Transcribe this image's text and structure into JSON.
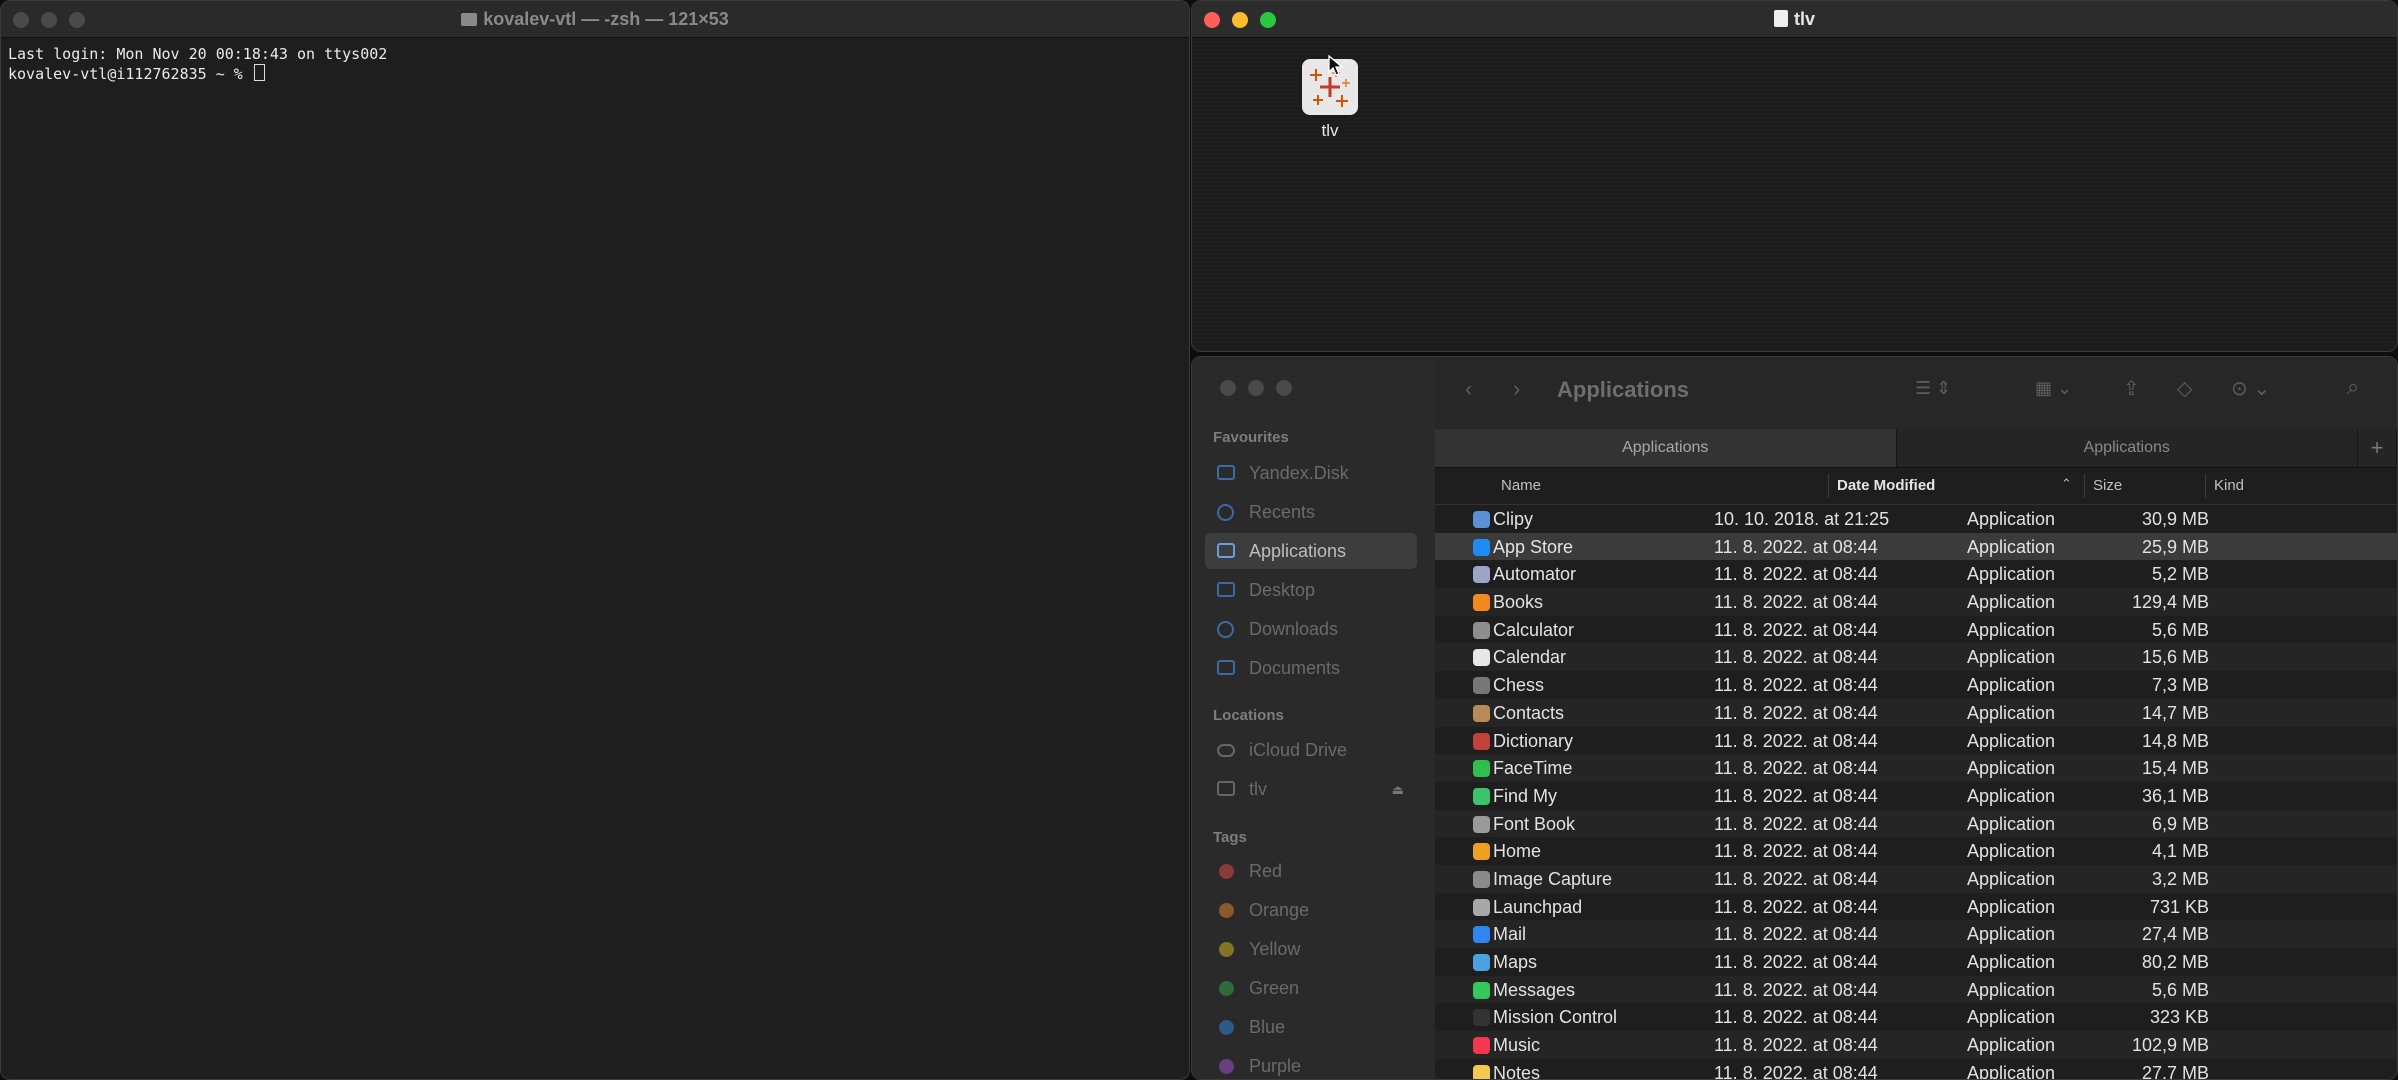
{
  "terminal": {
    "title": "kovalev-vtl — -zsh — 121×53",
    "lines": [
      "Last login: Mon Nov 20 00:18:43 on ttys002",
      "kovalev-vtl@i112762835 ~ % "
    ]
  },
  "volume_window": {
    "title": "tlv",
    "item_label": "tlv"
  },
  "finder": {
    "sidebar": {
      "favourites_label": "Favourites",
      "favourites": [
        "Yandex.Disk",
        "Recents",
        "Applications",
        "Desktop",
        "Downloads",
        "Documents"
      ],
      "locations_label": "Locations",
      "locations": [
        "iCloud Drive",
        "tlv"
      ],
      "tags_label": "Tags",
      "tags": [
        {
          "name": "Red",
          "color": "#8a3a38"
        },
        {
          "name": "Orange",
          "color": "#8a5a2a"
        },
        {
          "name": "Yellow",
          "color": "#857326"
        },
        {
          "name": "Green",
          "color": "#2f6b3a"
        },
        {
          "name": "Blue",
          "color": "#2e5a8a"
        },
        {
          "name": "Purple",
          "color": "#6a3f7e"
        }
      ]
    },
    "toolbar": {
      "title": "Applications"
    },
    "tabs": [
      "Applications",
      "Applications"
    ],
    "columns": {
      "name": "Name",
      "date": "Date Modified",
      "size": "Size",
      "kind": "Kind"
    },
    "rows": [
      {
        "name": "Clipy",
        "date": "10. 10. 2018. at 21:25",
        "size": "30,9 MB",
        "kind": "Application",
        "icon_color": "#5b8fd6"
      },
      {
        "name": "App Store",
        "date": "11. 8. 2022. at 08:44",
        "size": "25,9 MB",
        "kind": "Application",
        "icon_color": "#1b8cf3"
      },
      {
        "name": "Automator",
        "date": "11. 8. 2022. at 08:44",
        "size": "5,2 MB",
        "kind": "Application",
        "icon_color": "#9aa6c4"
      },
      {
        "name": "Books",
        "date": "11. 8. 2022. at 08:44",
        "size": "129,4 MB",
        "kind": "Application",
        "icon_color": "#f08a1c"
      },
      {
        "name": "Calculator",
        "date": "11. 8. 2022. at 08:44",
        "size": "5,6 MB",
        "kind": "Application",
        "icon_color": "#8e8e8e"
      },
      {
        "name": "Calendar",
        "date": "11. 8. 2022. at 08:44",
        "size": "15,6 MB",
        "kind": "Application",
        "icon_color": "#e8e8e8"
      },
      {
        "name": "Chess",
        "date": "11. 8. 2022. at 08:44",
        "size": "7,3 MB",
        "kind": "Application",
        "icon_color": "#777777"
      },
      {
        "name": "Contacts",
        "date": "11. 8. 2022. at 08:44",
        "size": "14,7 MB",
        "kind": "Application",
        "icon_color": "#b88a57"
      },
      {
        "name": "Dictionary",
        "date": "11. 8. 2022. at 08:44",
        "size": "14,8 MB",
        "kind": "Application",
        "icon_color": "#c2413b"
      },
      {
        "name": "FaceTime",
        "date": "11. 8. 2022. at 08:44",
        "size": "15,4 MB",
        "kind": "Application",
        "icon_color": "#2fbf4f"
      },
      {
        "name": "Find My",
        "date": "11. 8. 2022. at 08:44",
        "size": "36,1 MB",
        "kind": "Application",
        "icon_color": "#3ac36b"
      },
      {
        "name": "Font Book",
        "date": "11. 8. 2022. at 08:44",
        "size": "6,9 MB",
        "kind": "Application",
        "icon_color": "#9a9a9a"
      },
      {
        "name": "Home",
        "date": "11. 8. 2022. at 08:44",
        "size": "4,1 MB",
        "kind": "Application",
        "icon_color": "#f0a020"
      },
      {
        "name": "Image Capture",
        "date": "11. 8. 2022. at 08:44",
        "size": "3,2 MB",
        "kind": "Application",
        "icon_color": "#8a8a8a"
      },
      {
        "name": "Launchpad",
        "date": "11. 8. 2022. at 08:44",
        "size": "731 KB",
        "kind": "Application",
        "icon_color": "#a8a8a8"
      },
      {
        "name": "Mail",
        "date": "11. 8. 2022. at 08:44",
        "size": "27,4 MB",
        "kind": "Application",
        "icon_color": "#2f86f0"
      },
      {
        "name": "Maps",
        "date": "11. 8. 2022. at 08:44",
        "size": "80,2 MB",
        "kind": "Application",
        "icon_color": "#4aa3e0"
      },
      {
        "name": "Messages",
        "date": "11. 8. 2022. at 08:44",
        "size": "5,6 MB",
        "kind": "Application",
        "icon_color": "#34c759"
      },
      {
        "name": "Mission Control",
        "date": "11. 8. 2022. at 08:44",
        "size": "323 KB",
        "kind": "Application",
        "icon_color": "#333333"
      },
      {
        "name": "Music",
        "date": "11. 8. 2022. at 08:44",
        "size": "102,9 MB",
        "kind": "Application",
        "icon_color": "#f2374f"
      },
      {
        "name": "Notes",
        "date": "11. 8. 2022. at 08:44",
        "size": "27,7 MB",
        "kind": "Application",
        "icon_color": "#f2c94c"
      }
    ],
    "selected_row": "App Store",
    "colors": {
      "accent": "#3b6aa5",
      "selection": "#3b3b3b"
    }
  }
}
